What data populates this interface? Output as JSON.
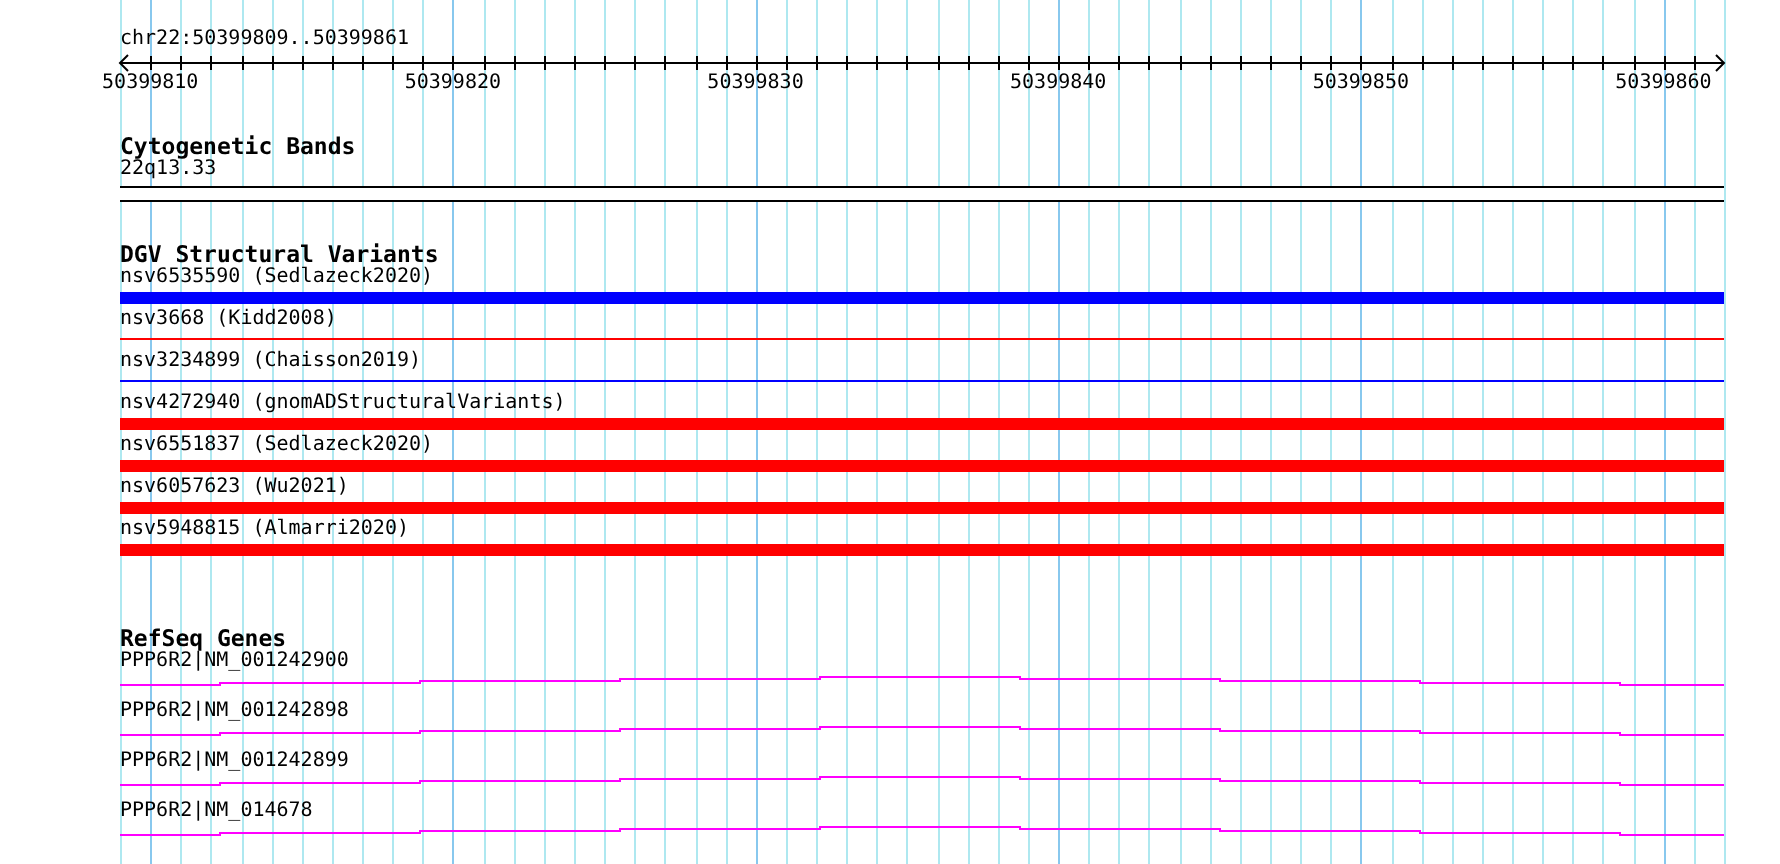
{
  "ruler": {
    "location": "chr22:50399809..50399861",
    "tick_labels": [
      "50399810",
      "50399820",
      "50399830",
      "50399840",
      "50399850",
      "50399860"
    ]
  },
  "tracks": [
    {
      "title": "Cytogenetic Bands",
      "features": [
        {
          "label": "22q13.33",
          "kind": "box"
        }
      ]
    },
    {
      "title": "DGV Structural Variants",
      "features": [
        {
          "label": "nsv6535590 (Sedlazeck2020)",
          "kind": "thick",
          "color": "#0000ff"
        },
        {
          "label": "nsv3668 (Kidd2008)",
          "kind": "thin",
          "color": "#ff0000"
        },
        {
          "label": "nsv3234899 (Chaisson2019)",
          "kind": "thin",
          "color": "#0000ff"
        },
        {
          "label": "nsv4272940 (gnomADStructuralVariants)",
          "kind": "thick",
          "color": "#ff0000"
        },
        {
          "label": "nsv6551837 (Sedlazeck2020)",
          "kind": "thick",
          "color": "#ff0000"
        },
        {
          "label": "nsv6057623 (Wu2021)",
          "kind": "thick",
          "color": "#ff0000"
        },
        {
          "label": "nsv5948815 (Almarri2020)",
          "kind": "thick",
          "color": "#ff0000"
        }
      ]
    },
    {
      "title": "RefSeq Genes",
      "features": [
        {
          "label": "PPP6R2|NM_001242900",
          "kind": "transcript"
        },
        {
          "label": "PPP6R2|NM_001242898",
          "kind": "transcript"
        },
        {
          "label": "PPP6R2|NM_001242899",
          "kind": "transcript"
        },
        {
          "label": "PPP6R2|NM_014678",
          "kind": "transcript"
        }
      ]
    }
  ]
}
